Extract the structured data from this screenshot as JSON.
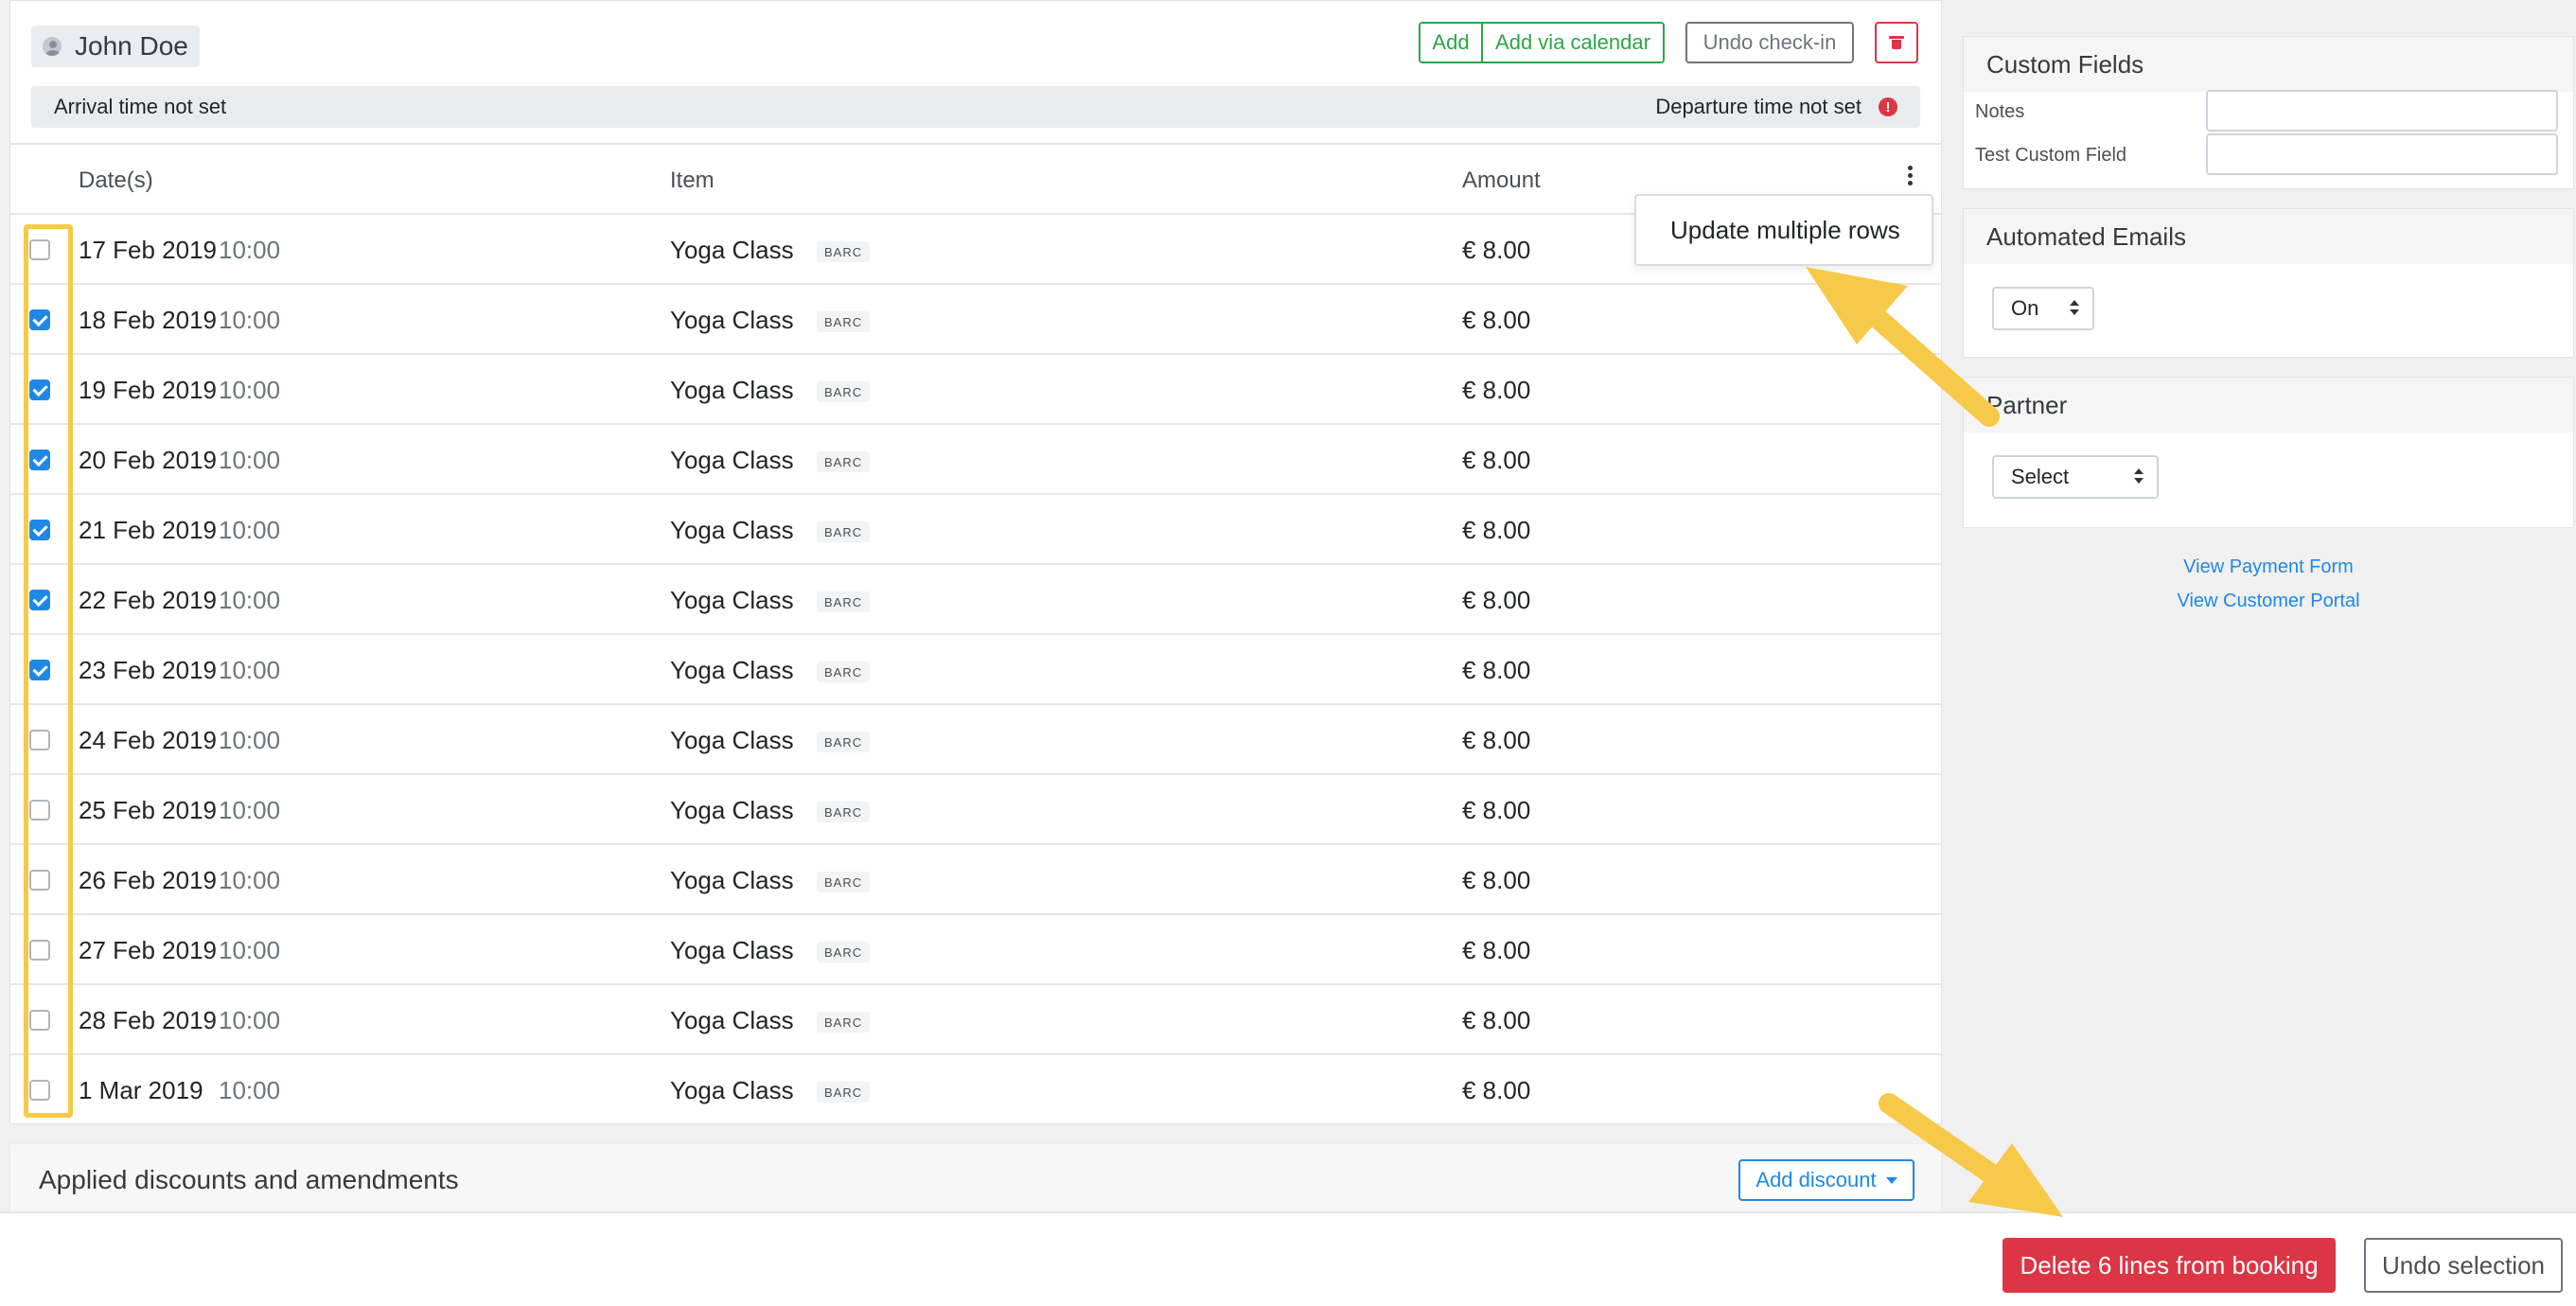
{
  "guest": {
    "name": "John Doe"
  },
  "toolbar": {
    "add_label": "Add",
    "add_calendar_label": "Add via calendar",
    "undo_checkin_label": "Undo check-in"
  },
  "times": {
    "arrival": "Arrival time not set",
    "departure": "Departure time not set",
    "alert_glyph": "!"
  },
  "table": {
    "headers": {
      "dates": "Date(s)",
      "item": "Item",
      "amount": "Amount"
    },
    "rows": [
      {
        "date": "17 Feb 2019",
        "time": "10:00",
        "item": "Yoga Class",
        "tag": "BARC",
        "amount": "€ 8.00",
        "checked": false
      },
      {
        "date": "18 Feb 2019",
        "time": "10:00",
        "item": "Yoga Class",
        "tag": "BARC",
        "amount": "€ 8.00",
        "checked": true
      },
      {
        "date": "19 Feb 2019",
        "time": "10:00",
        "item": "Yoga Class",
        "tag": "BARC",
        "amount": "€ 8.00",
        "checked": true
      },
      {
        "date": "20 Feb 2019",
        "time": "10:00",
        "item": "Yoga Class",
        "tag": "BARC",
        "amount": "€ 8.00",
        "checked": true
      },
      {
        "date": "21 Feb 2019",
        "time": "10:00",
        "item": "Yoga Class",
        "tag": "BARC",
        "amount": "€ 8.00",
        "checked": true
      },
      {
        "date": "22 Feb 2019",
        "time": "10:00",
        "item": "Yoga Class",
        "tag": "BARC",
        "amount": "€ 8.00",
        "checked": true
      },
      {
        "date": "23 Feb 2019",
        "time": "10:00",
        "item": "Yoga Class",
        "tag": "BARC",
        "amount": "€ 8.00",
        "checked": true
      },
      {
        "date": "24 Feb 2019",
        "time": "10:00",
        "item": "Yoga Class",
        "tag": "BARC",
        "amount": "€ 8.00",
        "checked": false
      },
      {
        "date": "25 Feb 2019",
        "time": "10:00",
        "item": "Yoga Class",
        "tag": "BARC",
        "amount": "€ 8.00",
        "checked": false
      },
      {
        "date": "26 Feb 2019",
        "time": "10:00",
        "item": "Yoga Class",
        "tag": "BARC",
        "amount": "€ 8.00",
        "checked": false
      },
      {
        "date": "27 Feb 2019",
        "time": "10:00",
        "item": "Yoga Class",
        "tag": "BARC",
        "amount": "€ 8.00",
        "checked": false
      },
      {
        "date": "28 Feb 2019",
        "time": "10:00",
        "item": "Yoga Class",
        "tag": "BARC",
        "amount": "€ 8.00",
        "checked": false
      },
      {
        "date": "1 Mar 2019",
        "time": "10:00",
        "item": "Yoga Class",
        "tag": "BARC",
        "amount": "€ 8.00",
        "checked": false
      }
    ]
  },
  "dropdown": {
    "update_multiple_label": "Update multiple rows"
  },
  "discounts": {
    "title": "Applied discounts and amendments",
    "add_label": "Add discount"
  },
  "footer": {
    "delete_label": "Delete 6 lines from booking",
    "undo_selection_label": "Undo selection"
  },
  "sidebar": {
    "custom_fields": {
      "title": "Custom Fields",
      "notes_label": "Notes",
      "notes_value": "",
      "test_field_label": "Test Custom Field",
      "test_field_value": ""
    },
    "automated_emails": {
      "title": "Automated Emails",
      "selected": "On"
    },
    "partner": {
      "title": "Partner",
      "selected": "Select"
    },
    "links": {
      "payment_form": "View Payment Form",
      "customer_portal": "View Customer Portal"
    }
  },
  "colors": {
    "success": "#28a745",
    "danger": "#dc3545",
    "primary": "#1e88e5",
    "highlight": "#f7c948"
  },
  "icons": {
    "avatar": "user-avatar-icon",
    "trash": "trash-icon",
    "kebab": "kebab-menu-icon",
    "alert": "alert-circle-icon",
    "caret": "caret-down-icon",
    "select": "updown-arrows-icon"
  }
}
